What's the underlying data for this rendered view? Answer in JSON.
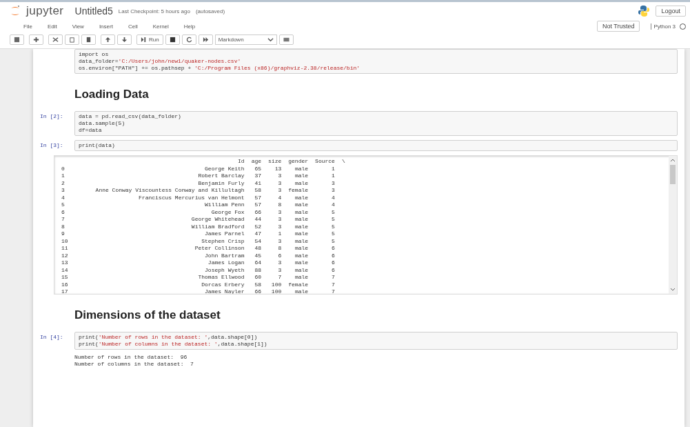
{
  "header": {
    "logo_text": "jupyter",
    "notebook_name": "Untitled5",
    "checkpoint": "Last Checkpoint: 5 hours ago",
    "autosave_status": "(autosaved)",
    "logout": "Logout"
  },
  "menu": {
    "items": [
      "File",
      "Edit",
      "View",
      "Insert",
      "Cell",
      "Kernel",
      "Help"
    ],
    "trust_status": "Not Trusted",
    "kernel_name": "Python 3",
    "kernel_busy": false
  },
  "toolbar": {
    "run_label": "Run",
    "cell_type": "Markdown"
  },
  "cells": [
    {
      "kind": "code",
      "source": [
        "import os",
        "data_folder='C:/Users/john/new1/quaker-nodes.csv'",
        "os.environ[\"PATH\"] += os.pathsep + 'C:/Program Files (x86)/graphviz-2.38/release/bin'"
      ]
    },
    {
      "kind": "heading",
      "text": "Loading Data"
    },
    {
      "kind": "code",
      "prompt": "In [2]:",
      "source": [
        "data = pd.read_csv(data_folder)",
        "data.sample(5)",
        "df=data"
      ]
    },
    {
      "kind": "code",
      "prompt": "In [3]:",
      "source": [
        "print(data)"
      ],
      "output": {
        "kind": "table",
        "columns": [
          "",
          "Id",
          "age",
          "size",
          "gender",
          "Source",
          "\\"
        ],
        "rows": [
          [
            "0",
            "George Keith",
            "65",
            "13",
            "male",
            "1"
          ],
          [
            "1",
            "Robert Barclay",
            "37",
            "3",
            "male",
            "1"
          ],
          [
            "2",
            "Benjamin Furly",
            "41",
            "3",
            "male",
            "3"
          ],
          [
            "3",
            "Anne Conway Viscountess Conway and Killultagh",
            "58",
            "3",
            "female",
            "3"
          ],
          [
            "4",
            "Franciscus Mercurius van Helmont",
            "57",
            "4",
            "male",
            "4"
          ],
          [
            "5",
            "William Penn",
            "57",
            "8",
            "male",
            "4"
          ],
          [
            "6",
            "George Fox",
            "66",
            "3",
            "male",
            "5"
          ],
          [
            "7",
            "George Whitehead",
            "44",
            "3",
            "male",
            "5"
          ],
          [
            "8",
            "William Bradford",
            "52",
            "3",
            "male",
            "5"
          ],
          [
            "9",
            "James Parnel",
            "47",
            "1",
            "male",
            "5"
          ],
          [
            "10",
            "Stephen Crisp",
            "54",
            "3",
            "male",
            "5"
          ],
          [
            "11",
            "Peter Collinson",
            "48",
            "8",
            "male",
            "6"
          ],
          [
            "12",
            "John Bartram",
            "45",
            "6",
            "male",
            "6"
          ],
          [
            "13",
            "James Logan",
            "64",
            "3",
            "male",
            "6"
          ],
          [
            "14",
            "Joseph Wyeth",
            "88",
            "3",
            "male",
            "6"
          ],
          [
            "15",
            "Thomas Ellwood",
            "60",
            "7",
            "male",
            "7"
          ],
          [
            "16",
            "Dorcas Erbery",
            "58",
            "100",
            "female",
            "7"
          ],
          [
            "17",
            "James Nayler",
            "66",
            "100",
            "male",
            "7"
          ]
        ]
      }
    },
    {
      "kind": "heading",
      "text": "Dimensions of the dataset"
    },
    {
      "kind": "code",
      "prompt": "In [4]:",
      "source": [
        "print('Number of rows in the dataset: ',data.shape[0])",
        "print('Number of columns in the dataset: ',data.shape[1])"
      ],
      "output": {
        "kind": "text",
        "lines": [
          "Number of rows in the dataset:  96",
          "Number of columns in the dataset:  7"
        ]
      }
    }
  ]
}
